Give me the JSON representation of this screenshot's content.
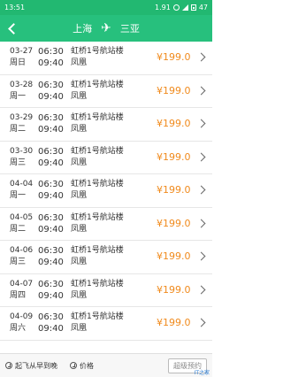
{
  "status_bar": {
    "time": "13:51",
    "speed": "1.91",
    "battery": "47"
  },
  "header": {
    "from": "上海",
    "to": "三亚"
  },
  "flights": [
    {
      "date": "03-27",
      "weekday": "周日",
      "dep": "06:30",
      "arr": "09:40",
      "airport": "虹桥1号航站楼",
      "arr_airport": "凤凰",
      "price": "¥199.0"
    },
    {
      "date": "03-28",
      "weekday": "周一",
      "dep": "06:30",
      "arr": "09:40",
      "airport": "虹桥1号航站楼",
      "arr_airport": "凤凰",
      "price": "¥199.0"
    },
    {
      "date": "03-29",
      "weekday": "周二",
      "dep": "06:30",
      "arr": "09:40",
      "airport": "虹桥1号航站楼",
      "arr_airport": "凤凰",
      "price": "¥199.0"
    },
    {
      "date": "03-30",
      "weekday": "周三",
      "dep": "06:30",
      "arr": "09:40",
      "airport": "虹桥1号航站楼",
      "arr_airport": "凤凰",
      "price": "¥199.0"
    },
    {
      "date": "04-04",
      "weekday": "周一",
      "dep": "06:30",
      "arr": "09:40",
      "airport": "虹桥1号航站楼",
      "arr_airport": "凤凰",
      "price": "¥199.0"
    },
    {
      "date": "04-05",
      "weekday": "周二",
      "dep": "06:30",
      "arr": "09:40",
      "airport": "虹桥1号航站楼",
      "arr_airport": "凤凰",
      "price": "¥199.0"
    },
    {
      "date": "04-06",
      "weekday": "周三",
      "dep": "06:30",
      "arr": "09:40",
      "airport": "虹桥1号航站楼",
      "arr_airport": "凤凰",
      "price": "¥199.0"
    },
    {
      "date": "04-07",
      "weekday": "周四",
      "dep": "06:30",
      "arr": "09:40",
      "airport": "虹桥1号航站楼",
      "arr_airport": "凤凰",
      "price": "¥199.0"
    },
    {
      "date": "04-09",
      "weekday": "周六",
      "dep": "06:30",
      "arr": "09:40",
      "airport": "虹桥1号航站楼",
      "arr_airport": "凤凰",
      "price": "¥199.0"
    }
  ],
  "bottom_bar": {
    "sort_label": "起飞从早到晚",
    "price_label": "价格",
    "super_button": "超级预约"
  },
  "watermark": "IT之家"
}
